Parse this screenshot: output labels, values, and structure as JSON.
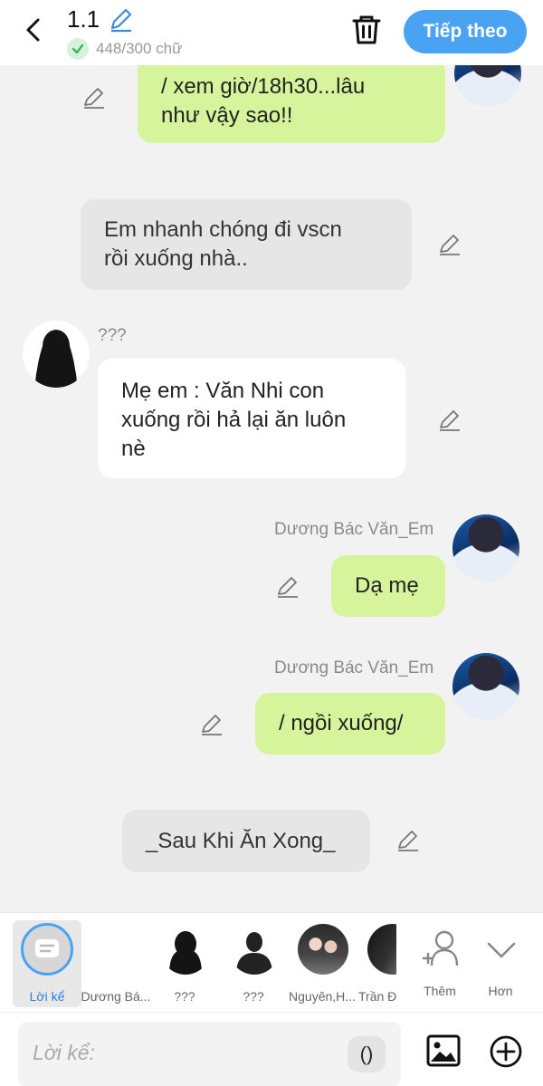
{
  "header": {
    "title": "1.1",
    "counter": "448/300 chữ",
    "next_label": "Tiếp theo"
  },
  "messages": [
    {
      "lines": [
        "/ xem giờ/18h30...lâu",
        "như vậy sao!!"
      ]
    },
    {
      "lines": [
        "Em nhanh chóng đi vscn",
        "rồi xuống nhà.."
      ]
    },
    {
      "sender": "???",
      "lines": [
        "Mẹ em : Văn Nhi con",
        "xuống rồi hả lại ăn luôn",
        "nè"
      ]
    },
    {
      "sender": "Dương Bác Văn_Em",
      "lines": [
        "Dạ mẹ"
      ]
    },
    {
      "sender": "Dương Bác Văn_Em",
      "lines": [
        "/ ngồi xuống/"
      ]
    },
    {
      "lines": [
        "_Sau Khi Ăn Xong_"
      ]
    }
  ],
  "characters": [
    {
      "label": "Lời kể"
    },
    {
      "label": "Dương Bá..."
    },
    {
      "label": "???"
    },
    {
      "label": "???"
    },
    {
      "label": "Nguyên,H..."
    },
    {
      "label": "Trần Đ"
    },
    {
      "label": "Thêm"
    },
    {
      "label": "Hơn"
    }
  ],
  "input": {
    "placeholder": "Lời kể:",
    "paren_label": "()"
  },
  "colors": {
    "accent": "#4aa3f2",
    "green_bubble": "#d6f49c",
    "white_bubble": "#ffffff",
    "narration_bubble": "#e6e6e6",
    "background": "#f2f2f2"
  },
  "icons": [
    "back-arrow-icon",
    "pencil-icon",
    "check-icon",
    "trash-icon",
    "narration-icon",
    "add-person-icon",
    "chevron-down-icon",
    "image-icon",
    "plus-circle-icon"
  ]
}
